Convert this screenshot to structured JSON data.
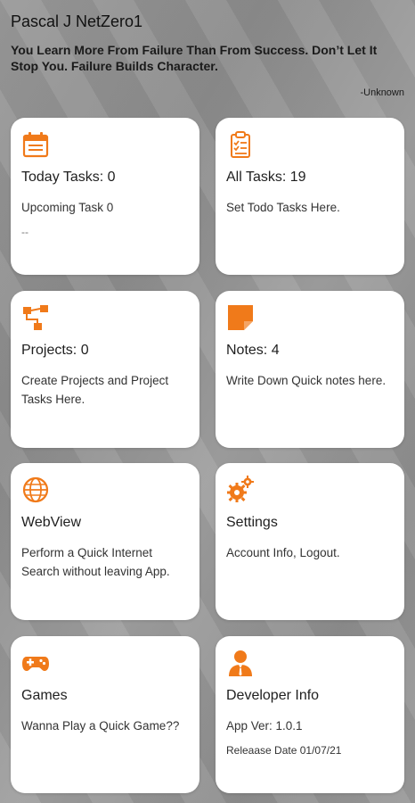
{
  "header": {
    "user_name": "Pascal J NetZero1",
    "quote": "You Learn More From Failure Than From Success. Don’t Let It Stop You. Failure Builds Character.",
    "quote_author": "-Unknown"
  },
  "accent_color": "#F07A1A",
  "cards": [
    {
      "icon": "calendar-icon",
      "title": "Today Tasks: 0",
      "desc": "Upcoming Task 0",
      "extra": "--"
    },
    {
      "icon": "clipboard-checklist-icon",
      "title": "All Tasks: 19",
      "desc": "Set Todo Tasks Here."
    },
    {
      "icon": "project-hierarchy-icon",
      "title": "Projects: 0",
      "desc": "Create Projects and Project Tasks Here."
    },
    {
      "icon": "sticky-note-icon",
      "title": "Notes: 4",
      "desc": "Write Down Quick notes here."
    },
    {
      "icon": "globe-icon",
      "title": "WebView",
      "desc": "Perform a Quick Internet Search without leaving App."
    },
    {
      "icon": "gears-icon",
      "title": "Settings",
      "desc": "Account Info, Logout."
    },
    {
      "icon": "gamepad-icon",
      "title": "Games",
      "desc": "Wanna Play a Quick Game??"
    },
    {
      "icon": "developer-person-icon",
      "title": "Developer Info",
      "desc": "App Ver: 1.0.1",
      "extra": "Releaase Date 01/07/21"
    }
  ]
}
